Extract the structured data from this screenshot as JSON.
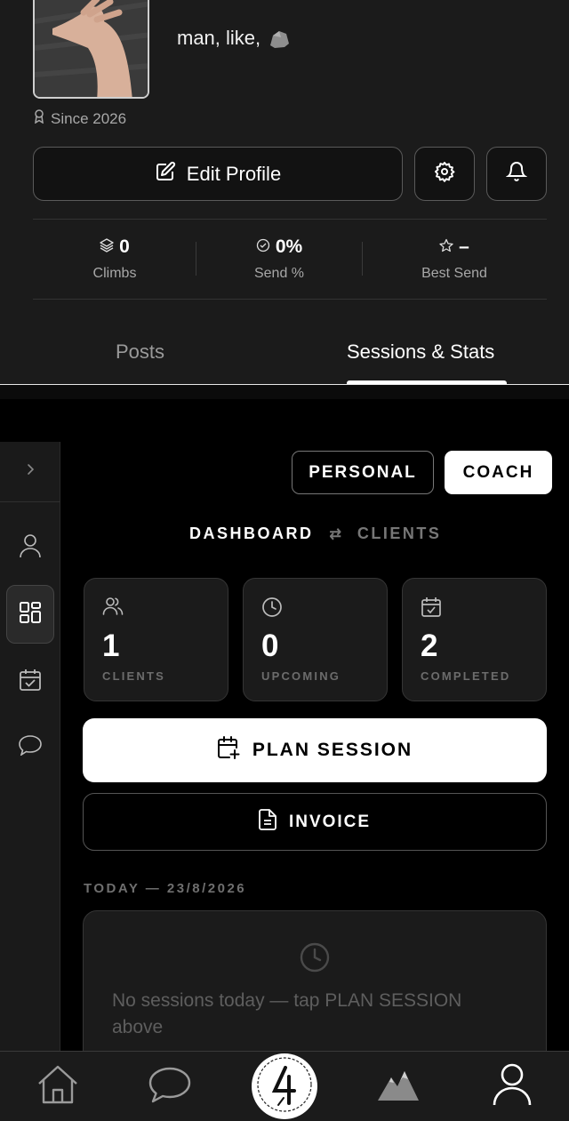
{
  "profile": {
    "bio": "man, like,",
    "since": "Since 2026",
    "edit_label": "Edit Profile",
    "stats": [
      {
        "value": "0",
        "label": "Climbs",
        "icon": "layers-icon"
      },
      {
        "value": "0%",
        "label": "Send %",
        "icon": "check-circle-icon"
      },
      {
        "value": "–",
        "label": "Best Send",
        "icon": "star-icon"
      }
    ],
    "tabs": {
      "posts": "Posts",
      "sessions": "Sessions & Stats",
      "active": "Sessions & Stats"
    }
  },
  "mode": {
    "personal": "PERSONAL",
    "coach": "COACH",
    "active": "COACH"
  },
  "subnav": {
    "dashboard": "DASHBOARD",
    "swap": "⇄",
    "clients": "CLIENTS",
    "active": "DASHBOARD"
  },
  "cards": [
    {
      "value": "1",
      "label": "CLIENTS",
      "icon": "users-icon"
    },
    {
      "value": "0",
      "label": "UPCOMING",
      "icon": "clock-icon"
    },
    {
      "value": "2",
      "label": "COMPLETED",
      "icon": "calendar-check-icon"
    }
  ],
  "actions": {
    "plan": "PLAN SESSION",
    "invoice": "INVOICE"
  },
  "today": {
    "heading": "TODAY — 23/8/2026",
    "empty": "No sessions today — tap PLAN SESSION above"
  },
  "sidebar": {
    "items": [
      "profile-icon",
      "dashboard-icon",
      "calendar-icon",
      "chat-icon"
    ],
    "active": "dashboard-icon"
  },
  "bottom_nav": {
    "items": [
      "home-icon",
      "chat-icon",
      "climb-logo-icon",
      "mountain-icon",
      "profile-icon"
    ]
  },
  "colors": {
    "background": "#000000",
    "panel": "#1b1b1b",
    "accent": "#ffffff",
    "muted": "#6c6c6c"
  }
}
